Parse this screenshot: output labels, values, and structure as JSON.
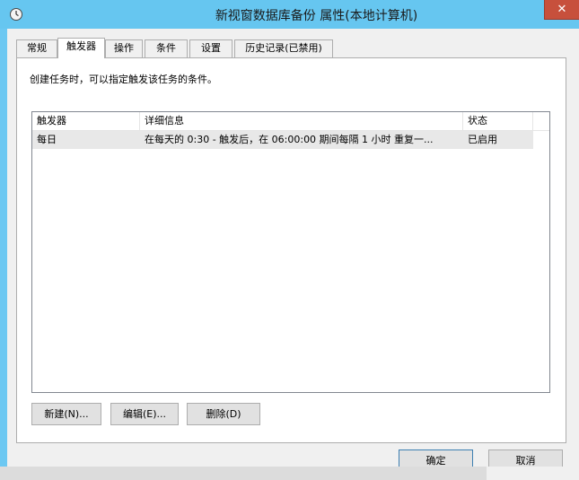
{
  "window": {
    "title": "新视窗数据库备份 属性(本地计算机)",
    "close_glyph": "✕",
    "icon": "clock-icon"
  },
  "tabs": [
    {
      "label": "常规"
    },
    {
      "label": "触发器"
    },
    {
      "label": "操作"
    },
    {
      "label": "条件"
    },
    {
      "label": "设置"
    },
    {
      "label": "历史记录(已禁用)"
    }
  ],
  "active_tab": "触发器",
  "panel": {
    "description": "创建任务时，可以指定触发该任务的条件。",
    "columns": [
      "触发器",
      "详细信息",
      "状态"
    ],
    "rows": [
      {
        "trigger": "每日",
        "details": "在每天的 0:30 - 触发后，在 06:00:00 期间每隔 1 小时 重复一...",
        "status": "已启用"
      }
    ]
  },
  "buttons": {
    "new": "新建(N)...",
    "edit": "编辑(E)...",
    "delete": "删除(D)",
    "ok": "确定",
    "cancel": "取消"
  }
}
